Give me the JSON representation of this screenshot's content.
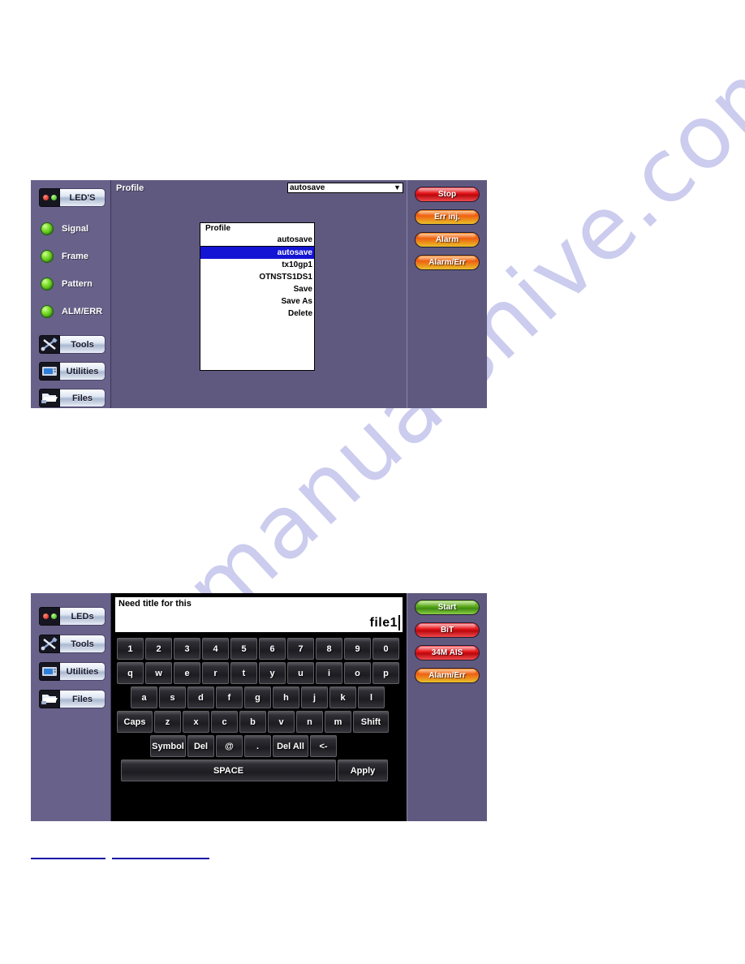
{
  "watermark": {
    "text": "manualshive.com"
  },
  "panel1": {
    "sidebar": {
      "nav_top": [
        {
          "label": "LED'S",
          "icon": "leds-icon"
        }
      ],
      "leds": [
        {
          "label": "Signal",
          "color": "#5aa81c"
        },
        {
          "label": "Frame",
          "color": "#5aa81c"
        },
        {
          "label": "Pattern",
          "color": "#5aa81c"
        },
        {
          "label": "ALM/ERR",
          "color": "#5aa81c"
        }
      ],
      "nav_bottom": [
        {
          "label": "Tools",
          "icon": "tools-icon"
        },
        {
          "label": "Utilities",
          "icon": "utilities-icon"
        },
        {
          "label": "Files",
          "icon": "files-icon"
        }
      ]
    },
    "main": {
      "field_label": "Profile",
      "combo": {
        "value": "autosave",
        "arrow": "▼"
      },
      "listbox": {
        "header": "Profile",
        "current": "autosave",
        "items": [
          {
            "label": "autosave",
            "selected": true
          },
          {
            "label": "tx10gp1",
            "selected": false
          },
          {
            "label": "OTNSTS1DS1",
            "selected": false
          },
          {
            "label": "Save",
            "selected": false
          },
          {
            "label": "Save As",
            "selected": false
          },
          {
            "label": "Delete",
            "selected": false
          }
        ]
      }
    },
    "rightbar": [
      {
        "label": "Stop",
        "color": "red"
      },
      {
        "label": "Err inj.",
        "color": "orange"
      },
      {
        "label": "Alarm",
        "color": "orange"
      },
      {
        "label": "Alarm/Err",
        "color": "orange"
      }
    ]
  },
  "panel2": {
    "sidebar": {
      "nav": [
        {
          "label": "LEDs",
          "icon": "leds-icon"
        },
        {
          "label": "Tools",
          "icon": "tools-icon"
        },
        {
          "label": "Utilities",
          "icon": "utilities-icon"
        },
        {
          "label": "Files",
          "icon": "files-icon"
        }
      ]
    },
    "editor": {
      "title": "Need title for this",
      "value": "file1"
    },
    "keyboard": {
      "rows": [
        {
          "indent": "row-ind-1",
          "keys": [
            {
              "label": "1"
            },
            {
              "label": "2"
            },
            {
              "label": "3"
            },
            {
              "label": "4"
            },
            {
              "label": "5"
            },
            {
              "label": "6"
            },
            {
              "label": "7"
            },
            {
              "label": "8"
            },
            {
              "label": "9"
            },
            {
              "label": "0"
            }
          ]
        },
        {
          "indent": "row-ind-2",
          "keys": [
            {
              "label": "q"
            },
            {
              "label": "w"
            },
            {
              "label": "e"
            },
            {
              "label": "r"
            },
            {
              "label": "t"
            },
            {
              "label": "y"
            },
            {
              "label": "u"
            },
            {
              "label": "i"
            },
            {
              "label": "o"
            },
            {
              "label": "p"
            }
          ]
        },
        {
          "indent": "row-ind-3",
          "keys": [
            {
              "label": "a"
            },
            {
              "label": "s"
            },
            {
              "label": "d"
            },
            {
              "label": "f"
            },
            {
              "label": "g"
            },
            {
              "label": "h"
            },
            {
              "label": "j"
            },
            {
              "label": "k"
            },
            {
              "label": "l"
            }
          ]
        },
        {
          "indent": "row-ind-4",
          "keys": [
            {
              "label": "Caps",
              "cls": "wide"
            },
            {
              "label": "z"
            },
            {
              "label": "x"
            },
            {
              "label": "c"
            },
            {
              "label": "b"
            },
            {
              "label": "v"
            },
            {
              "label": "n"
            },
            {
              "label": "m"
            },
            {
              "label": "Shift",
              "cls": "wide"
            }
          ]
        },
        {
          "indent": "row-ind-5",
          "keys": [
            {
              "label": "Symbol",
              "cls": "wide"
            },
            {
              "label": "Del"
            },
            {
              "label": "@"
            },
            {
              "label": "."
            },
            {
              "label": "Del All",
              "cls": "wide"
            },
            {
              "label": "<-"
            }
          ]
        },
        {
          "indent": "row-ind-6",
          "keys": [
            {
              "label": "SPACE",
              "cls": "space"
            },
            {
              "label": "Apply",
              "cls": "apply"
            }
          ]
        }
      ]
    },
    "rightbar": [
      {
        "label": "Start",
        "color": "green"
      },
      {
        "label": "BiT",
        "color": "red"
      },
      {
        "label": "34M AIS",
        "color": "red"
      },
      {
        "label": "Alarm/Err",
        "color": "orange"
      }
    ]
  }
}
